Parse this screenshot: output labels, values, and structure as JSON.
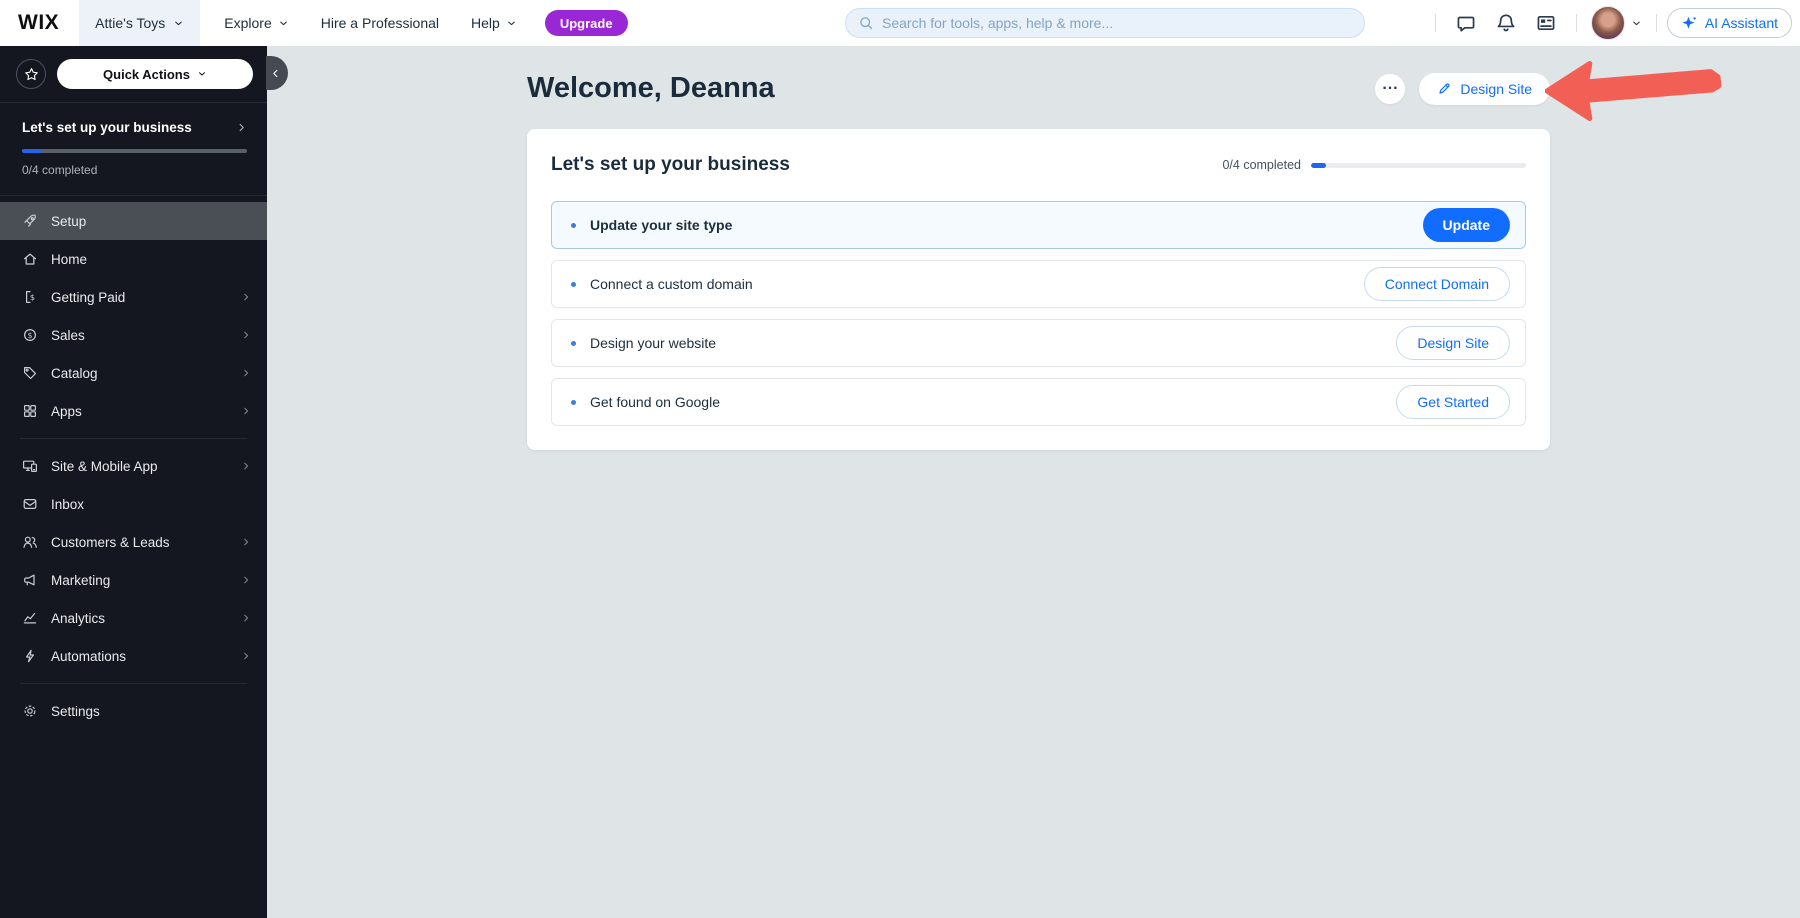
{
  "colors": {
    "accent": "#116DFF",
    "upgrade_purple": "#9A27D5",
    "progress_blue": "#2463EB",
    "annotation_arrow_red": "#F15F55",
    "sidebar_bg": "#14171F",
    "main_bg": "#DFE4E7"
  },
  "topbar": {
    "logo": "WIX",
    "site_name": "Attie's Toys",
    "nav": {
      "explore": "Explore",
      "hire": "Hire a Professional",
      "help": "Help"
    },
    "upgrade_label": "Upgrade",
    "search_placeholder": "Search for tools, apps, help & more...",
    "icons": [
      "messages-icon",
      "notifications-icon",
      "updates-icon"
    ],
    "ai_assistant_label": "AI Assistant"
  },
  "sidebar": {
    "quick_actions_label": "Quick Actions",
    "setup_progress": {
      "title": "Let's set up your business",
      "completed_text": "0/4 completed",
      "percent": 9
    },
    "menu": [
      {
        "label": "Setup",
        "icon": "rocket",
        "active": true,
        "chevron": false
      },
      {
        "label": "Home",
        "icon": "home",
        "chevron": false
      },
      {
        "label": "Getting Paid",
        "icon": "invoice",
        "chevron": true
      },
      {
        "label": "Sales",
        "icon": "dollar",
        "chevron": true
      },
      {
        "label": "Catalog",
        "icon": "tag",
        "chevron": true
      },
      {
        "label": "Apps",
        "icon": "apps",
        "chevron": true,
        "divider_after": true
      },
      {
        "label": "Site & Mobile App",
        "icon": "devices",
        "chevron": true
      },
      {
        "label": "Inbox",
        "icon": "envelope",
        "chevron": false
      },
      {
        "label": "Customers & Leads",
        "icon": "people",
        "chevron": true
      },
      {
        "label": "Marketing",
        "icon": "megaphone",
        "chevron": true
      },
      {
        "label": "Analytics",
        "icon": "chart",
        "chevron": true
      },
      {
        "label": "Automations",
        "icon": "bolt",
        "chevron": true,
        "divider_after": true
      },
      {
        "label": "Settings",
        "icon": "gear",
        "chevron": false
      }
    ]
  },
  "main": {
    "greeting": "Welcome, Deanna",
    "more_label": "···",
    "design_site_label": "Design Site",
    "card": {
      "title": "Let's set up your business",
      "completed_text": "0/4 completed",
      "progress_percent": 7,
      "tasks": [
        {
          "label": "Update your site type",
          "action": "Update",
          "variant": "primary",
          "highlighted": true
        },
        {
          "label": "Connect a custom domain",
          "action": "Connect Domain",
          "variant": "secondary"
        },
        {
          "label": "Design your website",
          "action": "Design Site",
          "variant": "secondary"
        },
        {
          "label": "Get found on Google",
          "action": "Get Started",
          "variant": "secondary"
        }
      ]
    }
  }
}
